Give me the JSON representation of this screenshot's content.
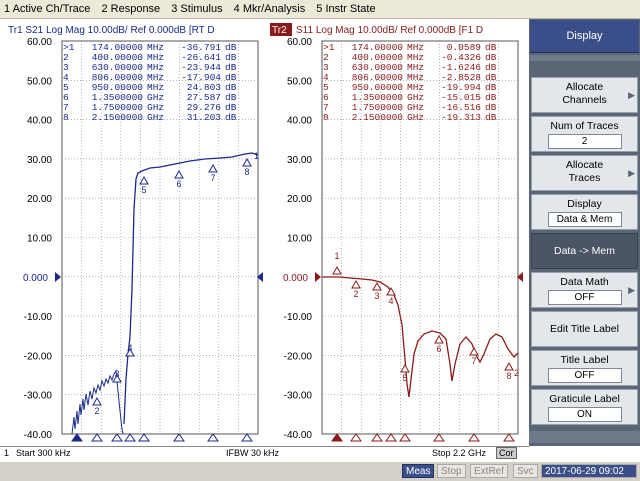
{
  "menubar": {
    "items": [
      "1 Active Ch/Trace",
      "2 Response",
      "3 Stimulus",
      "4 Mkr/Analysis",
      "5 Instr State"
    ]
  },
  "colors": {
    "trace1": "#1a2a8c",
    "trace2": "#8c1a1a",
    "accent": "#3a4f8a",
    "grid": "#7a7a7a"
  },
  "plot": {
    "ref_marker_label_left": "0.000",
    "ref_marker_label_right": "0.000",
    "y_ticks": [
      "60.00",
      "50.00",
      "40.00",
      "30.00",
      "20.00",
      "10.00",
      "0.000",
      "-10.00",
      "-20.00",
      "-30.00",
      "-40.00"
    ],
    "trace1": {
      "header": "Tr1  S21  Log Mag 10.00dB/ Ref 0.000dB  [RT D",
      "markers": [
        {
          "id": ">1",
          "freq": "174.00000",
          "unit": "MHz",
          "value": "-36.791",
          "dbu": "dB"
        },
        {
          "id": "2",
          "freq": "400.00000",
          "unit": "MHz",
          "value": "-26.641",
          "dbu": "dB"
        },
        {
          "id": "3",
          "freq": "630.00000",
          "unit": "MHz",
          "value": "-23.944",
          "dbu": "dB"
        },
        {
          "id": "4",
          "freq": "806.00000",
          "unit": "MHz",
          "value": "-17.904",
          "dbu": "dB"
        },
        {
          "id": "5",
          "freq": "950.00000",
          "unit": "MHz",
          "value": "24.803",
          "dbu": "dB"
        },
        {
          "id": "6",
          "freq": "1.3500000",
          "unit": "GHz",
          "value": "27.587",
          "dbu": "dB"
        },
        {
          "id": "7",
          "freq": "1.7500000",
          "unit": "GHz",
          "value": "29.276",
          "dbu": "dB"
        },
        {
          "id": "8",
          "freq": "2.1500000",
          "unit": "GHz",
          "value": "31.203",
          "dbu": "dB"
        }
      ]
    },
    "trace2": {
      "tag": "Tr2",
      "header": "S11  Log Mag 10.00dB/ Ref 0.000dB  [F1 D",
      "markers": [
        {
          "id": ">1",
          "freq": "174.00000",
          "unit": "MHz",
          "value": "0.0589",
          "dbu": "dB"
        },
        {
          "id": "2",
          "freq": "400.00000",
          "unit": "MHz",
          "value": "-0.4326",
          "dbu": "dB"
        },
        {
          "id": "3",
          "freq": "630.00000",
          "unit": "MHz",
          "value": "-1.6246",
          "dbu": "dB"
        },
        {
          "id": "4",
          "freq": "806.00000",
          "unit": "MHz",
          "value": "-2.8528",
          "dbu": "dB"
        },
        {
          "id": "5",
          "freq": "950.00000",
          "unit": "MHz",
          "value": "-19.994",
          "dbu": "dB"
        },
        {
          "id": "6",
          "freq": "1.3500000",
          "unit": "GHz",
          "value": "-15.015",
          "dbu": "dB"
        },
        {
          "id": "7",
          "freq": "1.7500000",
          "unit": "GHz",
          "value": "-16.516",
          "dbu": "dB"
        },
        {
          "id": "8",
          "freq": "2.1500000",
          "unit": "GHz",
          "value": "-19.313",
          "dbu": "dB"
        }
      ]
    }
  },
  "softkeys": {
    "title": "Display",
    "allocate_channels": "Allocate\nChannels",
    "num_traces_label": "Num of Traces",
    "num_traces_value": "2",
    "allocate_traces": "Allocate\nTraces",
    "display_label": "Display",
    "display_value": "Data & Mem",
    "data_to_mem": "Data -> Mem",
    "data_math_label": "Data Math",
    "data_math_value": "OFF",
    "edit_title_label": "Edit Title Label",
    "title_label_label": "Title Label",
    "title_label_value": "OFF",
    "graticule_label_label": "Graticule Label",
    "graticule_label_value": "ON"
  },
  "status": {
    "channel": "1",
    "start": "Start 300 kHz",
    "ifbw": "IFBW 30 kHz",
    "stop": "Stop 2.2 GHz",
    "cor": "Cor"
  },
  "taskbar": {
    "meas": "Meas",
    "stop": "Stop",
    "extref": "ExtRef",
    "svc": "Svc",
    "datetime": "2017-06-29 09:02"
  }
}
